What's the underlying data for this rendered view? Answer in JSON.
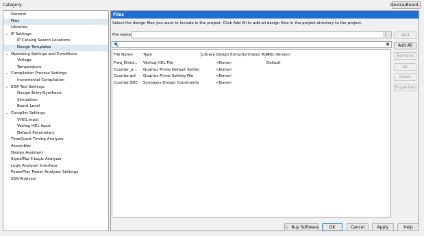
{
  "category_label": "Category:",
  "device_board_button": "Device/Board...",
  "tree": [
    {
      "label": "General",
      "level": 0,
      "expanded": null
    },
    {
      "label": "Files",
      "level": 0,
      "expanded": null,
      "selected": true
    },
    {
      "label": "Libraries",
      "level": 0,
      "expanded": null
    },
    {
      "label": "IP Settings",
      "level": 0,
      "expanded": true
    },
    {
      "label": "IP Catalog Search Locations",
      "level": 1,
      "expanded": null
    },
    {
      "label": "Design Templates",
      "level": 1,
      "expanded": null,
      "highlight": true
    },
    {
      "label": "Operating Settings and Conditions",
      "level": 0,
      "expanded": true
    },
    {
      "label": "Voltage",
      "level": 1,
      "expanded": null
    },
    {
      "label": "Temperature",
      "level": 1,
      "expanded": null
    },
    {
      "label": "Compilation Process Settings",
      "level": 0,
      "expanded": true
    },
    {
      "label": "Incremental Compilation",
      "level": 1,
      "expanded": null
    },
    {
      "label": "EDA Tool Settings",
      "level": 0,
      "expanded": true
    },
    {
      "label": "Design Entry/Synthesis",
      "level": 1,
      "expanded": null
    },
    {
      "label": "Simulation",
      "level": 1,
      "expanded": null
    },
    {
      "label": "Board-Level",
      "level": 1,
      "expanded": null
    },
    {
      "label": "Compiler Settings",
      "level": 0,
      "expanded": true
    },
    {
      "label": "VHDL Input",
      "level": 1,
      "expanded": null
    },
    {
      "label": "Verilog HDL Input",
      "level": 1,
      "expanded": null
    },
    {
      "label": "Default Parameters",
      "level": 1,
      "expanded": null
    },
    {
      "label": "TimeQuest Timing Analyzer",
      "level": 0,
      "expanded": null
    },
    {
      "label": "Assembler",
      "level": 0,
      "expanded": null
    },
    {
      "label": "Design Assistant",
      "level": 0,
      "expanded": null
    },
    {
      "label": "SignalTap II Logic Analyzer",
      "level": 0,
      "expanded": null
    },
    {
      "label": "Logic Analyzer Interface",
      "level": 0,
      "expanded": null
    },
    {
      "label": "PowerPlay Power Analyzer Settings",
      "level": 0,
      "expanded": null
    },
    {
      "label": "SSN Analyzer",
      "level": 0,
      "expanded": null
    }
  ],
  "panel": {
    "title": "Files",
    "description": "Select the design files you want to include in the project. Click Add All to add all design files in the project directory to the project.",
    "file_name_label": "File name:",
    "file_name_value": "",
    "browse_label": "...",
    "filter_value": "",
    "side_buttons": {
      "add": "Add",
      "add_all": "Add All",
      "remove": "Remove",
      "up": "Up",
      "down": "Down",
      "properties": "Properties"
    },
    "columns": [
      "File Name",
      "Type",
      "Library",
      "Design Entry/Synthesis Tool",
      "HDL Version"
    ],
    "rows": [
      {
        "file": "Freq_Divid...",
        "type": "Verilog HDL File",
        "library": "",
        "tool": "<None>",
        "hdl": "Default"
      },
      {
        "file": "Counter_a...",
        "type": "Quartus Prime Default Setting F...",
        "library": "",
        "tool": "<None>",
        "hdl": ""
      },
      {
        "file": "Counter.qsf",
        "type": "Quartus Prime Setting File",
        "library": "",
        "tool": "<None>",
        "hdl": ""
      },
      {
        "file": "Counter.SDC",
        "type": "Synopsys Design Constraints File",
        "library": "",
        "tool": "<None>",
        "hdl": ""
      }
    ]
  },
  "footer": {
    "buy_software": "Buy Software",
    "ok": "OK",
    "cancel": "Cancel",
    "apply": "Apply",
    "help": "Help"
  },
  "colors": {
    "header_blue": "#1e6fd1",
    "selected_bg": "#dde8f3"
  }
}
